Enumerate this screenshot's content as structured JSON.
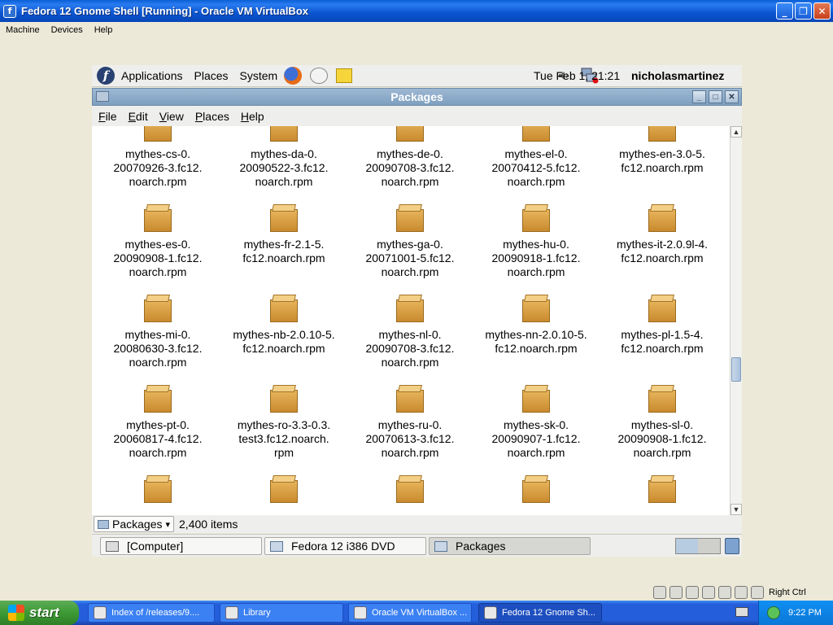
{
  "vbox": {
    "title": "Fedora 12 Gnome Shell [Running] - Oracle VM VirtualBox",
    "menu": [
      "Machine",
      "Devices",
      "Help"
    ],
    "host_key": "Right Ctrl"
  },
  "gnome_panel": {
    "menus": [
      "Applications",
      "Places",
      "System"
    ],
    "clock": "Tue Feb  1, 21:21",
    "user": "nicholasmartinez"
  },
  "nautilus": {
    "title": "Packages",
    "menu": [
      "File",
      "Edit",
      "View",
      "Places",
      "Help"
    ],
    "files": [
      "mythes-cs-0.\n20070926-3.fc12.\nnoarch.rpm",
      "mythes-da-0.\n20090522-3.fc12.\nnoarch.rpm",
      "mythes-de-0.\n20090708-3.fc12.\nnoarch.rpm",
      "mythes-el-0.\n20070412-5.fc12.\nnoarch.rpm",
      "mythes-en-3.0-5.\nfc12.noarch.rpm",
      "mythes-es-0.\n20090908-1.fc12.\nnoarch.rpm",
      "mythes-fr-2.1-5.\nfc12.noarch.rpm",
      "mythes-ga-0.\n20071001-5.fc12.\nnoarch.rpm",
      "mythes-hu-0.\n20090918-1.fc12.\nnoarch.rpm",
      "mythes-it-2.0.9l-4.\nfc12.noarch.rpm",
      "mythes-mi-0.\n20080630-3.fc12.\nnoarch.rpm",
      "mythes-nb-2.0.10-5.\nfc12.noarch.rpm",
      "mythes-nl-0.\n20090708-3.fc12.\nnoarch.rpm",
      "mythes-nn-2.0.10-5.\nfc12.noarch.rpm",
      "mythes-pl-1.5-4.\nfc12.noarch.rpm",
      "mythes-pt-0.\n20060817-4.fc12.\nnoarch.rpm",
      "mythes-ro-3.3-0.3.\ntest3.fc12.noarch.\nrpm",
      "mythes-ru-0.\n20070613-3.fc12.\nnoarch.rpm",
      "mythes-sk-0.\n20090907-1.fc12.\nnoarch.rpm",
      "mythes-sl-0.\n20090908-1.fc12.\nnoarch.rpm",
      "",
      "",
      "",
      "",
      ""
    ],
    "location": "Packages",
    "item_count": "2,400 items"
  },
  "bottom_panel": {
    "tasks": [
      "[Computer]",
      "Fedora 12 i386 DVD",
      "Packages"
    ]
  },
  "xp_taskbar": {
    "start": "start",
    "tasks": [
      "Index of /releases/9....",
      "Library",
      "Oracle VM VirtualBox ...",
      "Fedora 12 Gnome Sh..."
    ],
    "time": "9:22 PM"
  }
}
